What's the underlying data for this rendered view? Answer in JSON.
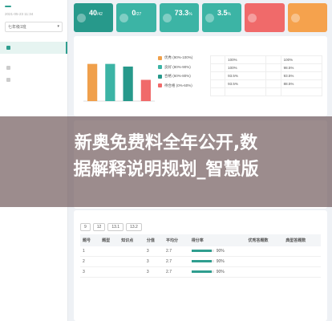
{
  "sidebar": {
    "tag": "",
    "back": "",
    "date": "2021-05-23 11:34",
    "title": "",
    "grade": "七年级1班",
    "items": [
      {
        "label": "",
        "active": true
      },
      {
        "label": "",
        "active": false
      },
      {
        "label": "",
        "active": false
      }
    ],
    "sub_items": [
      ""
    ]
  },
  "cards": [
    {
      "label": "",
      "value": "40",
      "suffix": "/42"
    },
    {
      "label": "",
      "value": "0",
      "suffix": "/27"
    },
    {
      "label": "",
      "value": "73.3",
      "suffix": "%"
    },
    {
      "label": "",
      "value": "3.5",
      "suffix": "%"
    },
    {
      "label": "",
      "value": "",
      "suffix": ""
    },
    {
      "label": "",
      "value": "",
      "suffix": ""
    }
  ],
  "colors": {
    "primary": "#2f9e8f",
    "teal": "#3cb4a5",
    "red": "#f06a6a",
    "orange": "#f5a24d"
  },
  "distribution": {
    "title": "",
    "legend": [
      {
        "label": "优秀 (90%-100%)",
        "count": "",
        "color": "#f0a04b"
      },
      {
        "label": "良好 (80%-90%)",
        "count": "",
        "color": "#3cb4a5"
      },
      {
        "label": "合格 (60%-80%)",
        "count": "",
        "color": "#27998b"
      },
      {
        "label": "待合格 (0%-60%)",
        "count": "",
        "color": "#f06a6a"
      }
    ],
    "students": [
      [
        "",
        "100%",
        "",
        "100%"
      ],
      [
        "",
        "100%",
        "",
        "98.5%"
      ],
      [
        "",
        "93.5%",
        "",
        "93.5%"
      ],
      [
        "",
        "93.5%",
        "",
        "88.5%"
      ],
      [
        "",
        "",
        "",
        ""
      ]
    ]
  },
  "chart_data": {
    "type": "bar",
    "categories": [
      "",
      "",
      "",
      ""
    ],
    "values": [
      14,
      14,
      13,
      8
    ],
    "colors": [
      "#f0a04b",
      "#3cb4a5",
      "#27998b",
      "#f06a6a"
    ],
    "ylim": [
      0,
      16
    ]
  },
  "banner": {
    "line1": "新奥免费料全年公开,数",
    "line2": "据解释说明规划_智慧版"
  },
  "questions": {
    "title": "",
    "note": "",
    "filters": [
      "9",
      "12",
      "13.1",
      "13.2"
    ],
    "headers": [
      "题号",
      "题型",
      "知识点",
      "分值",
      "平均分",
      "得分率",
      "优秀答题数",
      "典型答题数"
    ],
    "rows": [
      {
        "no": "1",
        "type": "",
        "kp": "",
        "score": "3",
        "avg": "2.7",
        "rate": "90%",
        "rate_num": 0.9
      },
      {
        "no": "2",
        "type": "",
        "kp": "",
        "score": "3",
        "avg": "2.7",
        "rate": "90%",
        "rate_num": 0.9
      },
      {
        "no": "3",
        "type": "",
        "kp": "",
        "score": "3",
        "avg": "2.7",
        "rate": "90%",
        "rate_num": 0.9
      }
    ]
  }
}
